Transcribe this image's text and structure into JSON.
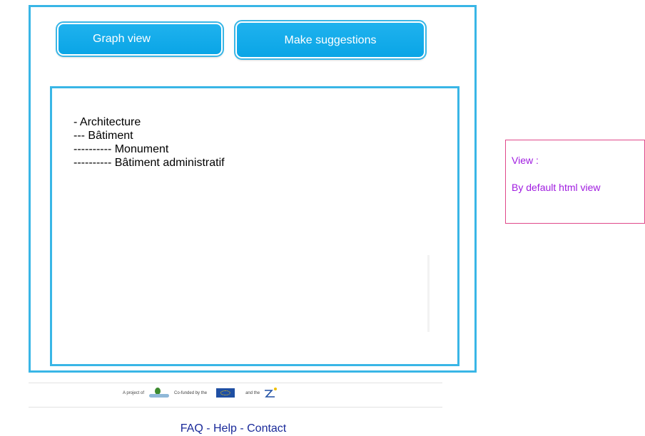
{
  "toolbar": {
    "graph_view_label": "Graph view",
    "make_suggestions_label": "Make suggestions"
  },
  "tree": {
    "items": [
      "- Architecture",
      "--- Bâtiment",
      "---------- Monument",
      "---------- Bâtiment administratif"
    ]
  },
  "note": {
    "title": "View :",
    "text": "By default html view"
  },
  "partners": {
    "project_of": "A project of",
    "cofunded_by": "Co-funded by the",
    "and_the": "and the"
  },
  "footer": {
    "faq": "FAQ",
    "separator": " - ",
    "help": "Help",
    "contact": "Contact"
  },
  "colors": {
    "frame_border": "#39b6e6",
    "button_fill": "#0aa5e6",
    "note_border": "#e0488a",
    "note_text": "#a01ce0",
    "footer_link": "#1a2a9a"
  }
}
